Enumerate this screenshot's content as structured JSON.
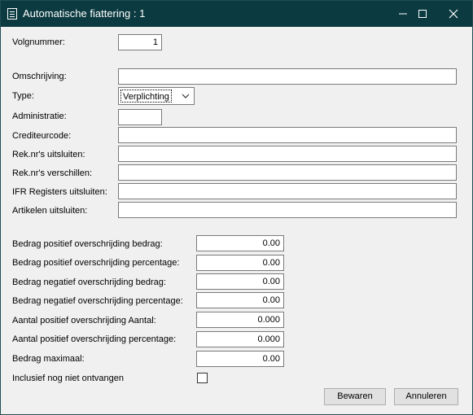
{
  "window": {
    "title": "Automatische fiattering : 1",
    "icon": "document-list-icon",
    "controls": {
      "minimize": "minimize-icon",
      "maximize": "maximize-icon",
      "close": "close-icon"
    }
  },
  "form": {
    "volgnummer": {
      "label": "Volgnummer:",
      "value": "1"
    },
    "omschrijving": {
      "label": "Omschrijving:",
      "value": ""
    },
    "type": {
      "label": "Type:",
      "value": "Verplichting",
      "icon": "chevron-down-icon"
    },
    "administratie": {
      "label": "Administratie:",
      "value": ""
    },
    "crediteurcode": {
      "label": "Crediteurcode:",
      "value": ""
    },
    "reknr_uitsluiten": {
      "label": "Rek.nr's uitsluiten:",
      "value": ""
    },
    "reknr_verschillen": {
      "label": "Rek.nr's verschillen:",
      "value": ""
    },
    "ifr_registers": {
      "label": "IFR Registers uitsluiten:",
      "value": ""
    },
    "artikelen": {
      "label": "Artikelen uitsluiten:",
      "value": ""
    },
    "bedrag_pos_bedrag": {
      "label": "Bedrag positief overschrijding bedrag:",
      "value": "0.00"
    },
    "bedrag_pos_perc": {
      "label": "Bedrag positief overschrijding percentage:",
      "value": "0.00"
    },
    "bedrag_neg_bedrag": {
      "label": "Bedrag negatief overschrijding bedrag:",
      "value": "0.00"
    },
    "bedrag_neg_perc": {
      "label": "Bedrag negatief overschrijding percentage:",
      "value": "0.00"
    },
    "aantal_pos_aantal": {
      "label": "Aantal positief overschrijding Aantal:",
      "value": "0.000"
    },
    "aantal_pos_perc": {
      "label": "Aantal positief overschrijding percentage:",
      "value": "0.000"
    },
    "bedrag_max": {
      "label": "Bedrag maximaal:",
      "value": "0.00"
    },
    "inclusief": {
      "label": "Inclusief nog niet ontvangen",
      "checked": false
    }
  },
  "buttons": {
    "save": "Bewaren",
    "cancel": "Annuleren"
  }
}
